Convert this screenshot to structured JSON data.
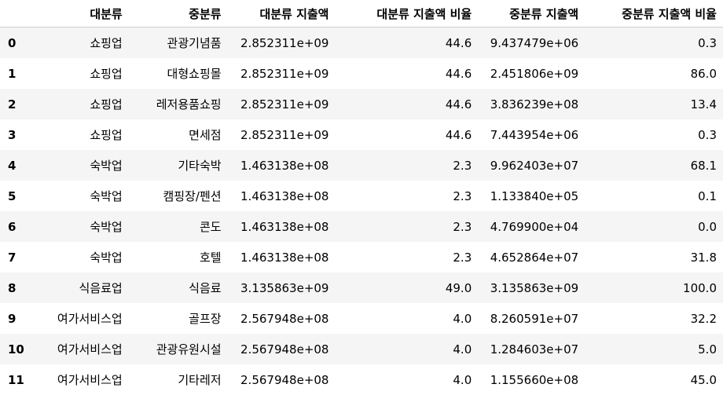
{
  "table": {
    "index_header": "",
    "columns": [
      "대분류",
      "중분류",
      "대분류 지출액",
      "대분류 지출액 비율",
      "중분류 지출액",
      "중분류 지출액 비율"
    ],
    "rows": [
      {
        "index": "0",
        "cells": [
          "쇼핑업",
          "관광기념품",
          "2.852311e+09",
          "44.6",
          "9.437479e+06",
          "0.3"
        ]
      },
      {
        "index": "1",
        "cells": [
          "쇼핑업",
          "대형쇼핑몰",
          "2.852311e+09",
          "44.6",
          "2.451806e+09",
          "86.0"
        ]
      },
      {
        "index": "2",
        "cells": [
          "쇼핑업",
          "레저용품쇼핑",
          "2.852311e+09",
          "44.6",
          "3.836239e+08",
          "13.4"
        ]
      },
      {
        "index": "3",
        "cells": [
          "쇼핑업",
          "면세점",
          "2.852311e+09",
          "44.6",
          "7.443954e+06",
          "0.3"
        ]
      },
      {
        "index": "4",
        "cells": [
          "숙박업",
          "기타숙박",
          "1.463138e+08",
          "2.3",
          "9.962403e+07",
          "68.1"
        ]
      },
      {
        "index": "5",
        "cells": [
          "숙박업",
          "캠핑장/펜션",
          "1.463138e+08",
          "2.3",
          "1.133840e+05",
          "0.1"
        ]
      },
      {
        "index": "6",
        "cells": [
          "숙박업",
          "콘도",
          "1.463138e+08",
          "2.3",
          "4.769900e+04",
          "0.0"
        ]
      },
      {
        "index": "7",
        "cells": [
          "숙박업",
          "호텔",
          "1.463138e+08",
          "2.3",
          "4.652864e+07",
          "31.8"
        ]
      },
      {
        "index": "8",
        "cells": [
          "식음료업",
          "식음료",
          "3.135863e+09",
          "49.0",
          "3.135863e+09",
          "100.0"
        ]
      },
      {
        "index": "9",
        "cells": [
          "여가서비스업",
          "골프장",
          "2.567948e+08",
          "4.0",
          "8.260591e+07",
          "32.2"
        ]
      },
      {
        "index": "10",
        "cells": [
          "여가서비스업",
          "관광유원시설",
          "2.567948e+08",
          "4.0",
          "1.284603e+07",
          "5.0"
        ]
      },
      {
        "index": "11",
        "cells": [
          "여가서비스업",
          "기타레저",
          "2.567948e+08",
          "4.0",
          "1.155660e+08",
          "45.0"
        ]
      }
    ]
  }
}
